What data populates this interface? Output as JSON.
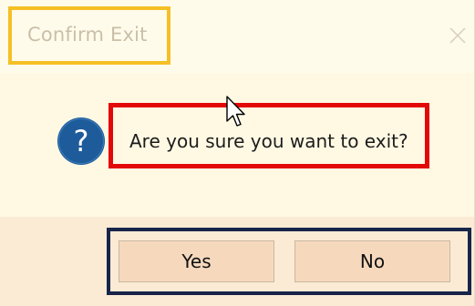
{
  "dialog": {
    "title": "Confirm Exit",
    "message": "Are you sure you want to exit?",
    "yes_label": "Yes",
    "no_label": "No",
    "icon": "question-icon",
    "close_icon": "close-icon"
  },
  "colors": {
    "background": "#fff9e3",
    "button_strip": "#fbebd4",
    "button_face": "#f6d9bd",
    "icon_blue": "#1e5b9a",
    "highlight_title": "#f5bf26",
    "highlight_message": "#e30909",
    "highlight_buttons": "#17254a"
  }
}
